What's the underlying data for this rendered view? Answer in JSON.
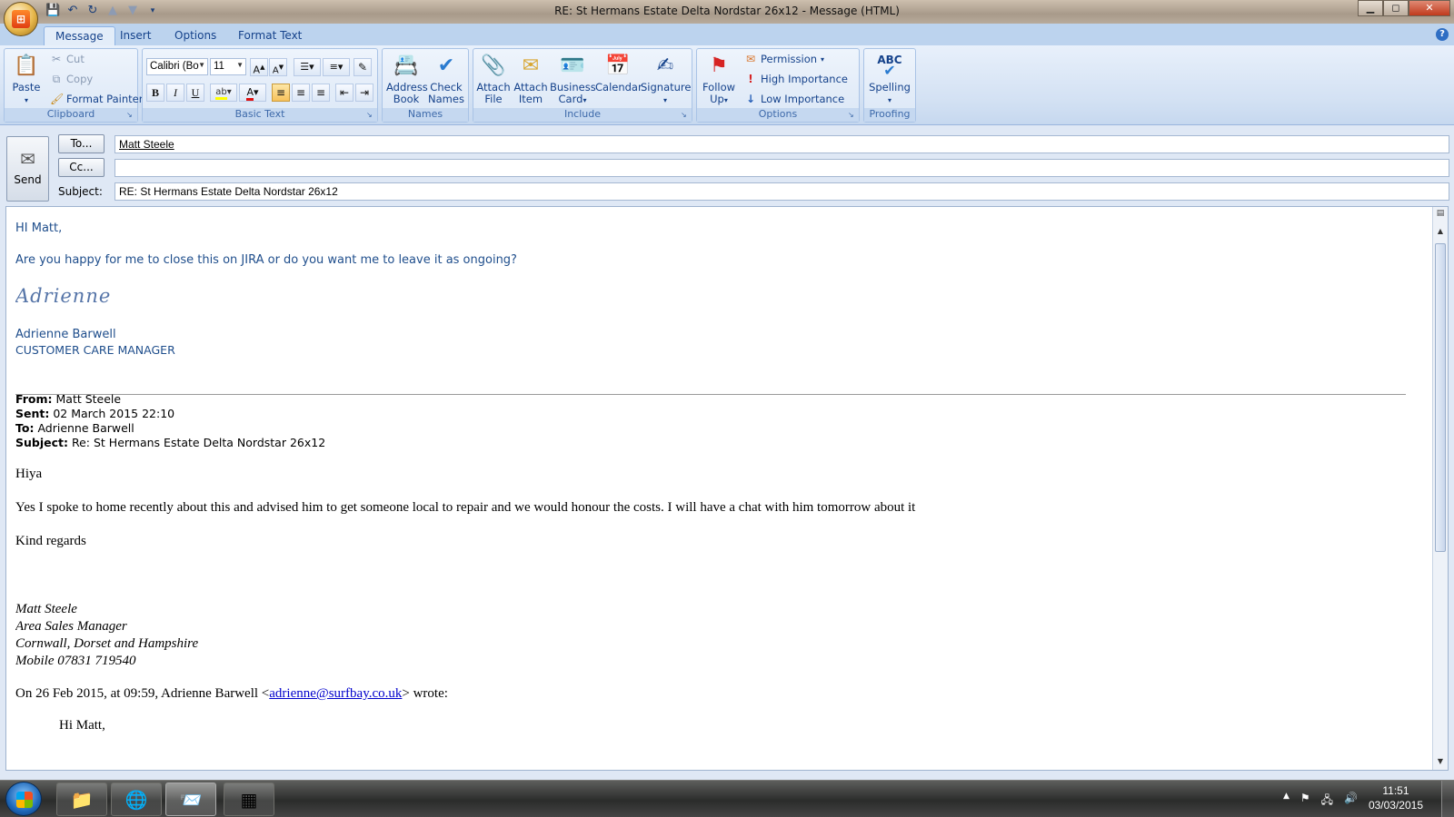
{
  "window": {
    "title": "RE: St Hermans Estate Delta Nordstar 26x12 - Message (HTML)",
    "minimize": "▁",
    "maximize": "◻",
    "close": "✕"
  },
  "tabs": [
    "Message",
    "Insert",
    "Options",
    "Format Text"
  ],
  "ribbon": {
    "clipboard": {
      "label": "Clipboard",
      "paste": "Paste",
      "cut": "Cut",
      "copy": "Copy",
      "format_painter": "Format Painter"
    },
    "basic_text": {
      "label": "Basic Text",
      "font_name": "Calibri (Bo",
      "font_size": "11",
      "bold": "B",
      "italic": "I",
      "underline": "U"
    },
    "names": {
      "label": "Names",
      "address_book_1": "Address",
      "address_book_2": "Book",
      "check_names_1": "Check",
      "check_names_2": "Names"
    },
    "include": {
      "label": "Include",
      "attach_file_1": "Attach",
      "attach_file_2": "File",
      "attach_item_1": "Attach",
      "attach_item_2": "Item",
      "business_card_1": "Business",
      "business_card_2": "Card",
      "calendar": "Calendar",
      "signature": "Signature"
    },
    "options": {
      "label": "Options",
      "follow_up_1": "Follow",
      "follow_up_2": "Up",
      "permission": "Permission",
      "high_importance": "High Importance",
      "low_importance": "Low Importance"
    },
    "proofing": {
      "label": "Proofing",
      "spelling": "Spelling",
      "abc": "ABC"
    }
  },
  "header": {
    "send": "Send",
    "to_button": "To...",
    "cc_button": "Cc...",
    "subject_label": "Subject:",
    "to_value": "Matt Steele",
    "cc_value": "",
    "subject_value": "RE: St Hermans Estate Delta Nordstar 26x12"
  },
  "body": {
    "greeting": "HI Matt,",
    "question": "Are you happy for me to close this on JIRA or do you want me to leave it as ongoing?",
    "signature_script": "Adrienne",
    "sig_name": "Adrienne Barwell",
    "sig_title": "CUSTOMER CARE MANAGER",
    "quoted": {
      "from_label": "From:",
      "from": "Matt Steele",
      "sent_label": "Sent:",
      "sent": "02 March 2015 22:10",
      "to_label": "To:",
      "to": "Adrienne Barwell",
      "subject_label": "Subject:",
      "subject": "Re: St Hermans Estate Delta Nordstar 26x12"
    },
    "hiya": "Hiya",
    "para1": "Yes I spoke to home recently about this and advised him to get someone local to repair and we would honour the costs.  I will have a chat with him tomorrow about it",
    "kind_regards": "Kind regards",
    "sender_sig": [
      "Matt Steele",
      "Area Sales Manager",
      "Cornwall, Dorset and Hampshire",
      "Mobile 07831 719540"
    ],
    "wrote_prefix": "On 26 Feb 2015, at 09:59, Adrienne Barwell <",
    "wrote_email": "adrienne@surfbay.co.uk",
    "wrote_suffix": "> wrote:",
    "nested_greeting": "Hi Matt,"
  },
  "taskbar": {
    "time": "11:51",
    "date": "03/03/2015"
  }
}
